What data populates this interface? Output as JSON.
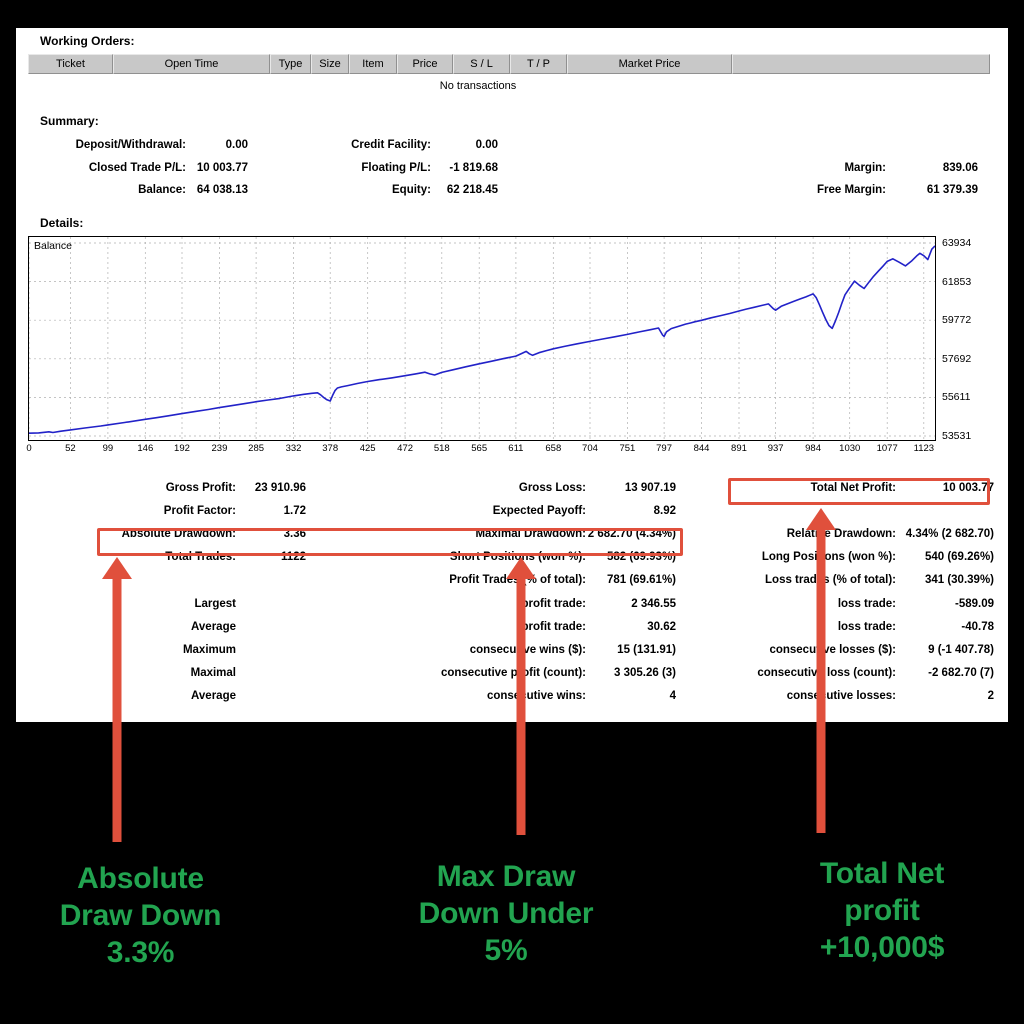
{
  "report": {
    "working_orders_title": "Working Orders:",
    "orders_columns": [
      "Ticket",
      "Open Time",
      "Type",
      "Size",
      "Item",
      "Price",
      "S / L",
      "T / P",
      "Market Price",
      ""
    ],
    "no_transactions": "No transactions",
    "summary_title": "Summary:",
    "details_title": "Details:",
    "summary": [
      [
        {
          "label": "Deposit/Withdrawal:",
          "value": "0.00"
        },
        {
          "label": "Credit Facility:",
          "value": "0.00"
        },
        {
          "label": "",
          "value": ""
        }
      ],
      [
        {
          "label": "Closed Trade P/L:",
          "value": "10 003.77"
        },
        {
          "label": "Floating P/L:",
          "value": "-1 819.68"
        },
        {
          "label": "Margin:",
          "value": "839.06"
        }
      ],
      [
        {
          "label": "Balance:",
          "value": "64 038.13"
        },
        {
          "label": "Equity:",
          "value": "62 218.45"
        },
        {
          "label": "Free Margin:",
          "value": "61 379.39"
        }
      ]
    ],
    "stats": [
      [
        {
          "label": "Gross Profit:",
          "value": "23 910.96"
        },
        {
          "label": "Gross Loss:",
          "value": "13 907.19"
        },
        {
          "label": "Total Net Profit:",
          "value": "10 003.77"
        }
      ],
      [
        {
          "label": "Profit Factor:",
          "value": "1.72"
        },
        {
          "label": "Expected Payoff:",
          "value": "8.92"
        },
        {
          "label": "",
          "value": ""
        }
      ],
      [
        {
          "label": "Absolute Drawdown:",
          "value": "3.36"
        },
        {
          "label": "Maximal Drawdown:",
          "value": "2 682.70 (4.34%)"
        },
        {
          "label": "Relative Drawdown:",
          "value": "4.34% (2 682.70)"
        }
      ],
      [
        {
          "label": "Total Trades:",
          "value": "1122"
        },
        {
          "label": "Short Positions (won %):",
          "value": "582 (69.93%)"
        },
        {
          "label": "Long Positions (won %):",
          "value": "540 (69.26%)"
        }
      ],
      [
        {
          "label": "",
          "value": ""
        },
        {
          "label": "Profit Trades (% of total):",
          "value": "781 (69.61%)"
        },
        {
          "label": "Loss trades (% of total):",
          "value": "341 (30.39%)"
        }
      ],
      [
        {
          "label": "Largest",
          "value": ""
        },
        {
          "label": "profit trade:",
          "value": "2 346.55"
        },
        {
          "label": "loss trade:",
          "value": "-589.09"
        }
      ],
      [
        {
          "label": "Average",
          "value": ""
        },
        {
          "label": "profit trade:",
          "value": "30.62"
        },
        {
          "label": "loss trade:",
          "value": "-40.78"
        }
      ],
      [
        {
          "label": "Maximum",
          "value": ""
        },
        {
          "label": "consecutive wins ($):",
          "value": "15 (131.91)"
        },
        {
          "label": "consecutive losses ($):",
          "value": "9 (-1 407.78)"
        }
      ],
      [
        {
          "label": "Maximal",
          "value": ""
        },
        {
          "label": "consecutive profit (count):",
          "value": "3 305.26 (3)"
        },
        {
          "label": "consecutive loss (count):",
          "value": "-2 682.70 (7)"
        }
      ],
      [
        {
          "label": "Average",
          "value": ""
        },
        {
          "label": "consecutive wins:",
          "value": "4"
        },
        {
          "label": "consecutive losses:",
          "value": "2"
        }
      ]
    ]
  },
  "annotations": {
    "accent_red": "#e0503c",
    "caption_green": "#22a450",
    "items": [
      {
        "line1": "Absolute",
        "line2": "Draw Down",
        "line3": "3.3%"
      },
      {
        "line1": "Max Draw",
        "line2": "Down Under",
        "line3": "5%"
      },
      {
        "line1": "Total Net",
        "line2": "profit",
        "line3": "+10,000$"
      }
    ]
  },
  "chart_data": {
    "type": "line",
    "title": "Balance",
    "xlabel": "",
    "ylabel": "",
    "line_color": "#2222c8",
    "grid": true,
    "legend": "Balance",
    "xlim": [
      0,
      1137
    ],
    "ylim": [
      53531,
      63934
    ],
    "xticks": [
      0,
      52,
      99,
      146,
      192,
      239,
      285,
      332,
      378,
      425,
      472,
      518,
      565,
      611,
      658,
      704,
      751,
      797,
      844,
      891,
      937,
      984,
      1030,
      1077,
      1123
    ],
    "yticks": [
      53531,
      55611,
      57692,
      59772,
      61853,
      63934
    ],
    "series": [
      {
        "name": "Balance",
        "x": [
          0,
          12,
          25,
          30,
          40,
          52,
          70,
          90,
          99,
          120,
          146,
          160,
          175,
          192,
          210,
          225,
          239,
          255,
          270,
          285,
          300,
          315,
          332,
          345,
          355,
          362,
          366,
          370,
          374,
          378,
          381,
          384,
          387,
          392,
          400,
          412,
          425,
          440,
          455,
          472,
          485,
          497,
          503,
          509,
          518,
          532,
          548,
          565,
          580,
          595,
          611,
          618,
          624,
          628,
          632,
          640,
          650,
          658,
          672,
          688,
          704,
          720,
          735,
          751,
          766,
          780,
          790,
          795,
          797,
          800,
          806,
          812,
          818,
          824,
          830,
          836,
          844,
          856,
          868,
          880,
          891,
          900,
          910,
          920,
          928,
          934,
          937,
          944,
          952,
          960,
          968,
          975,
          980,
          984,
          988,
          992,
          996,
          1000,
          1004,
          1008,
          1012,
          1016,
          1020,
          1024,
          1030,
          1036,
          1042,
          1048,
          1054,
          1060,
          1066,
          1072,
          1077,
          1084,
          1092,
          1100,
          1108,
          1114,
          1118,
          1123,
          1128,
          1133,
          1137
        ],
        "y": [
          53680,
          53700,
          53760,
          53720,
          53790,
          53860,
          53960,
          54070,
          54130,
          54260,
          54430,
          54520,
          54620,
          54740,
          54860,
          54960,
          55060,
          55170,
          55270,
          55380,
          55470,
          55560,
          55690,
          55780,
          55830,
          55860,
          55750,
          55600,
          55480,
          55420,
          55720,
          55980,
          56120,
          56180,
          56250,
          56360,
          56470,
          56570,
          56660,
          56780,
          56880,
          56970,
          56880,
          56820,
          56960,
          57100,
          57260,
          57420,
          57560,
          57700,
          57840,
          57970,
          58090,
          57960,
          57880,
          58020,
          58140,
          58230,
          58360,
          58500,
          58630,
          58760,
          58880,
          59010,
          59140,
          59260,
          59350,
          58980,
          58900,
          59150,
          59320,
          59400,
          59480,
          59560,
          59620,
          59690,
          59770,
          59900,
          60020,
          60140,
          60270,
          60370,
          60470,
          60570,
          60650,
          60400,
          60310,
          60520,
          60660,
          60790,
          60920,
          61030,
          61120,
          61190,
          60980,
          60600,
          60200,
          59810,
          59480,
          59330,
          59730,
          60180,
          60680,
          61140,
          61520,
          61880,
          61660,
          61480,
          61820,
          62140,
          62420,
          62700,
          62940,
          63080,
          62900,
          62700,
          62980,
          63240,
          63380,
          63250,
          63040,
          63600,
          63780,
          63620
        ]
      }
    ]
  }
}
